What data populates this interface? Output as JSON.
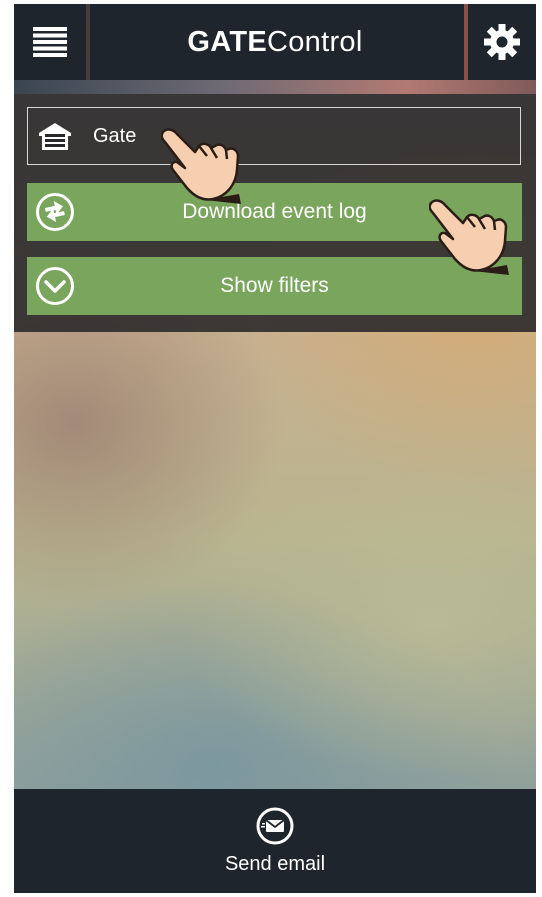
{
  "header": {
    "title_bold": "GATE",
    "title_light": "Control",
    "menu_icon": "hamburger-menu-icon",
    "settings_icon": "gear-icon"
  },
  "gate_selector": {
    "icon": "garage-icon",
    "label": "Gate"
  },
  "actions": [
    {
      "icon": "sync-arrows-icon",
      "label": "Download event log"
    },
    {
      "icon": "chevron-down-circle-icon",
      "label": "Show filters"
    }
  ],
  "footer": {
    "icon": "mail-icon",
    "label": "Send email"
  },
  "colors": {
    "bar": "#1f252c",
    "accent_green": "#7aa55d",
    "panel": "#28282a"
  }
}
